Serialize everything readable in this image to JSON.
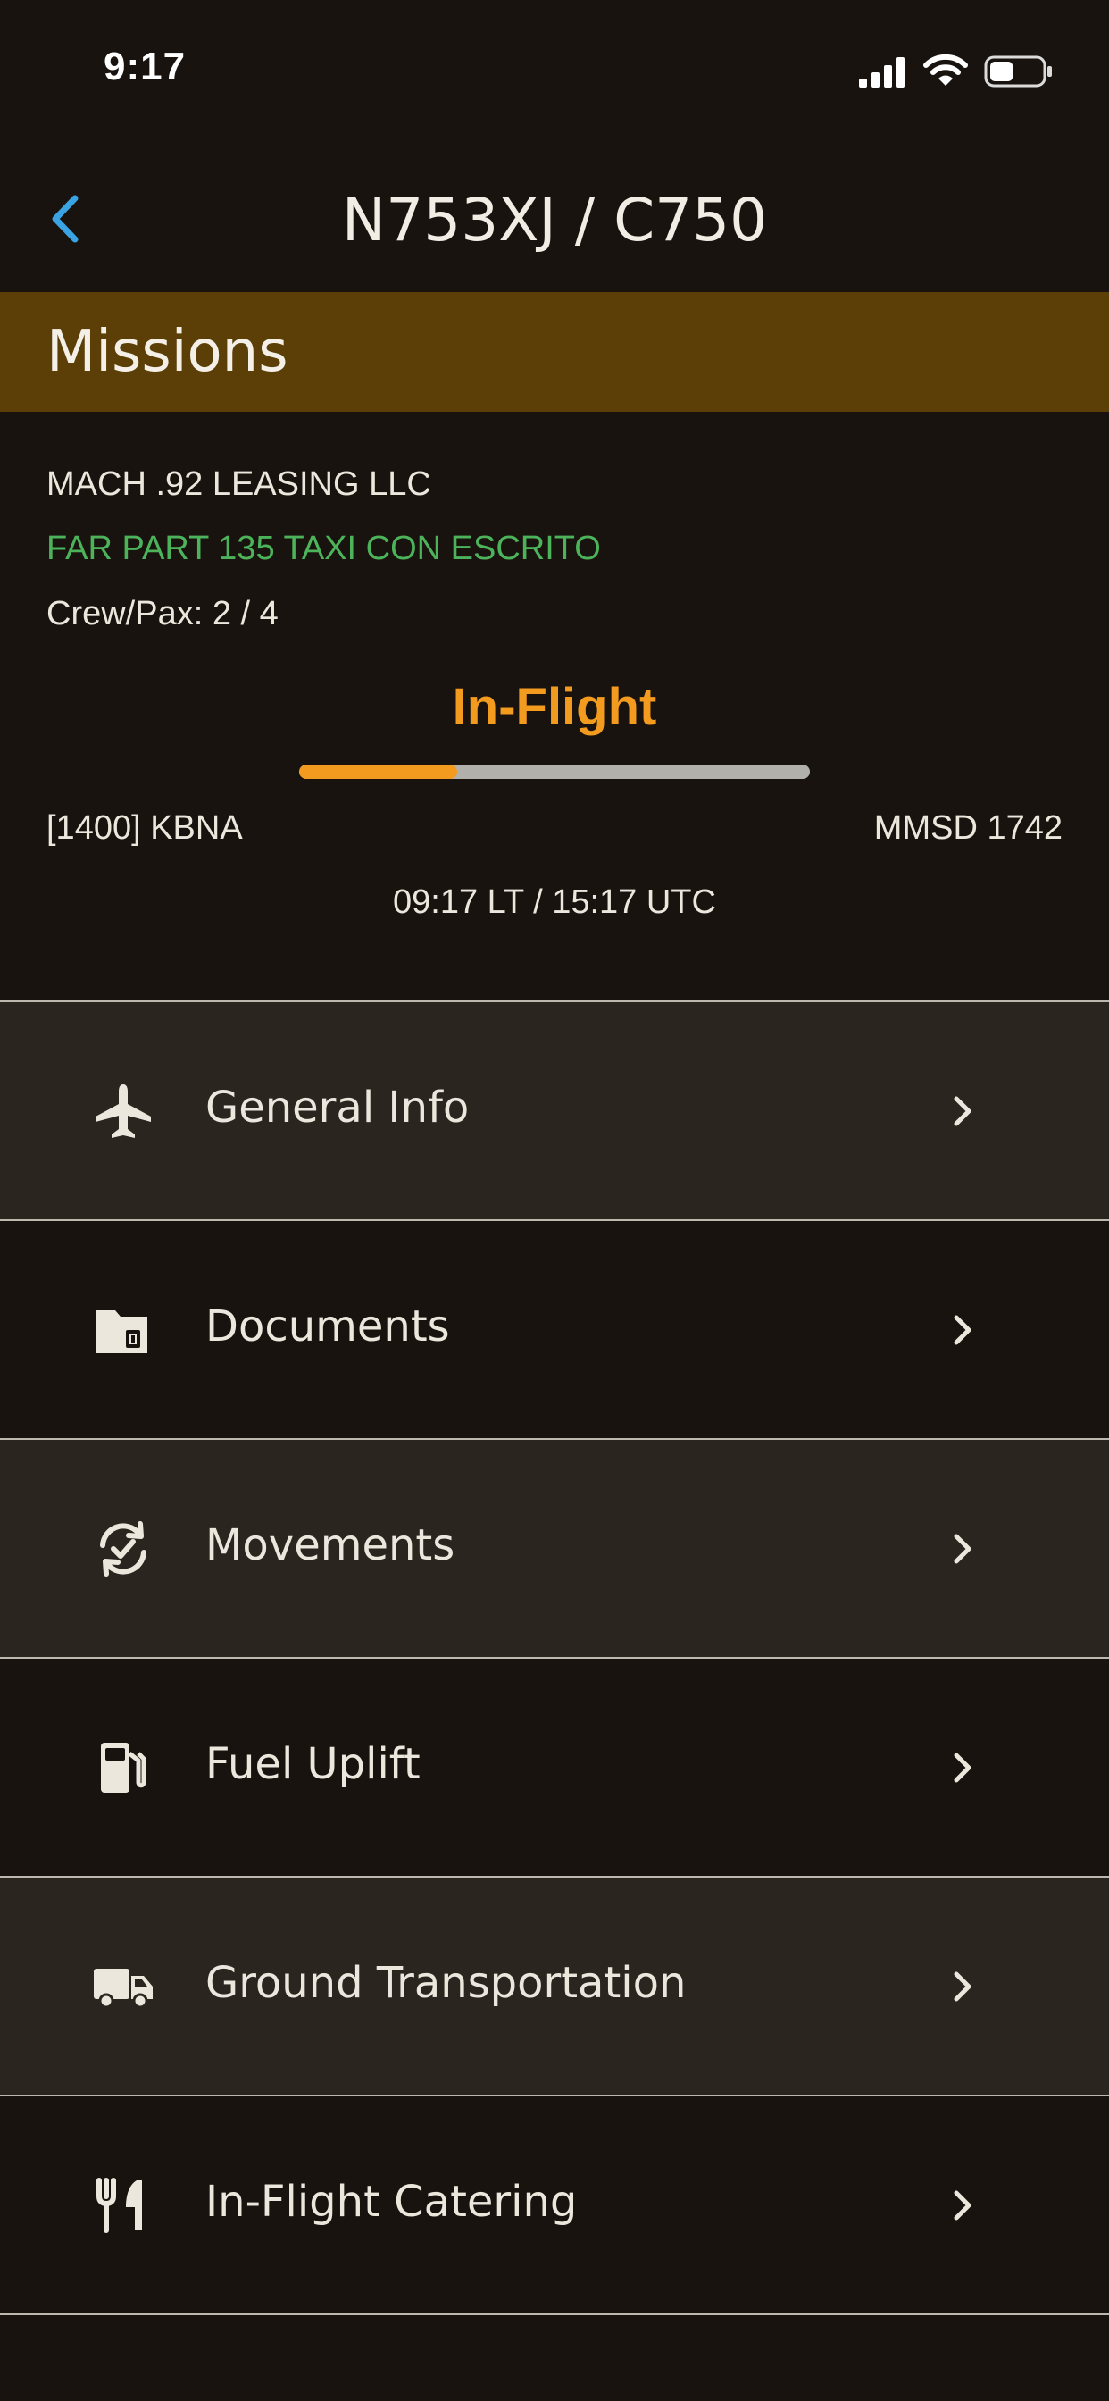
{
  "status_bar": {
    "time": "9:17",
    "battery_level": 0.45
  },
  "nav": {
    "back_icon": "chevron-left-icon",
    "title": "N753XJ / C750"
  },
  "section": {
    "title": "Missions"
  },
  "mission": {
    "operator": "MACH .92 LEASING LLC",
    "regulation": "FAR PART 135 TAXI CON ESCRITO",
    "crew_pax": "Crew/Pax: 2 / 4",
    "status": "In-Flight",
    "progress": 0.31,
    "origin": "[1400] KBNA",
    "destination": "MMSD 1742",
    "times": "09:17 LT / 15:17 UTC"
  },
  "menu": [
    {
      "label": "General Info",
      "icon": "airplane-icon"
    },
    {
      "label": "Documents",
      "icon": "folder-document-icon"
    },
    {
      "label": "Movements",
      "icon": "sync-check-icon"
    },
    {
      "label": "Fuel Uplift",
      "icon": "fuel-pump-icon"
    },
    {
      "label": "Ground Transportation",
      "icon": "truck-icon"
    },
    {
      "label": "In-Flight Catering",
      "icon": "fork-knife-icon"
    }
  ],
  "colors": {
    "background": "#18130e",
    "header": "#5b3f07",
    "accent": "#f39b1f",
    "green": "#4db35a",
    "back": "#3aa3e3"
  }
}
